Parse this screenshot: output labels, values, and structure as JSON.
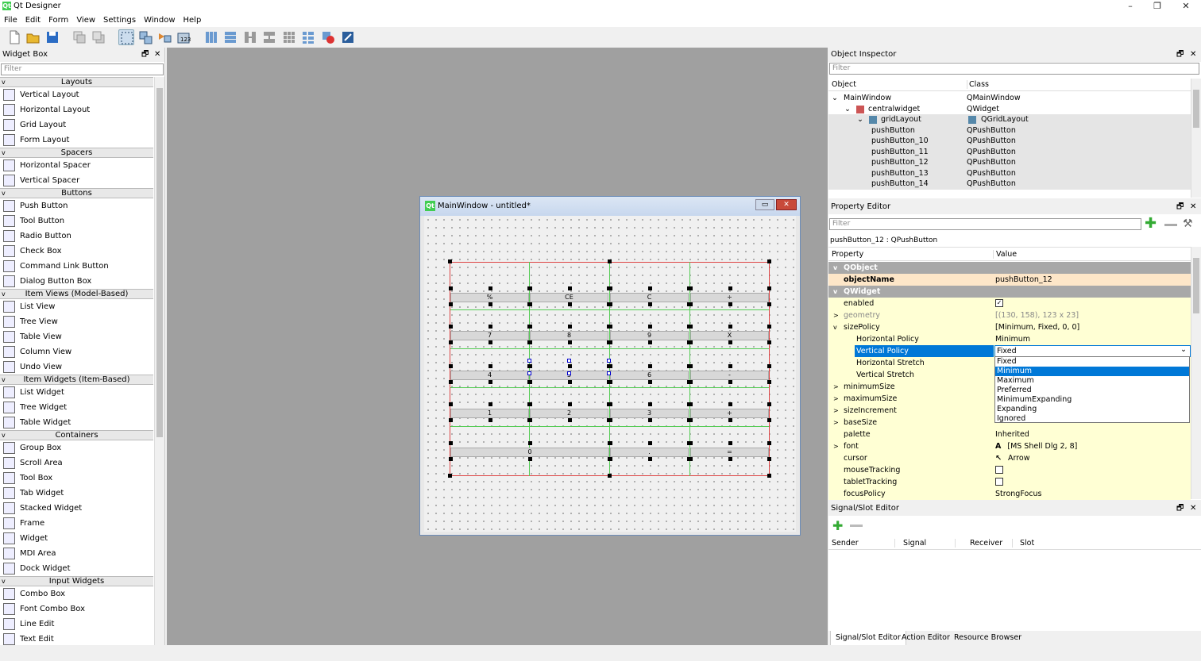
{
  "app": {
    "title": "Qt Designer",
    "icon": "qt-icon",
    "controls": [
      "–",
      "❐",
      "✕"
    ]
  },
  "menu": [
    "File",
    "Edit",
    "Form",
    "View",
    "Settings",
    "Window",
    "Help"
  ],
  "toolbar": [
    "new-icon",
    "open-icon",
    "save-icon",
    "send-backward-icon",
    "bring-forward-icon",
    "edit-widgets-icon",
    "edit-signals-icon",
    "edit-buddies-icon",
    "edit-tab-order-icon",
    "layout-horizontal-icon",
    "layout-vertical-icon",
    "layout-splitter-h-icon",
    "layout-splitter-v-icon",
    "layout-grid-icon",
    "layout-form-icon",
    "break-layout-icon",
    "adjust-size-icon"
  ],
  "widgetbox": {
    "title": "Widget Box",
    "filter": "Filter",
    "rows": [
      {
        "cat": "Layouts"
      },
      {
        "label": "Vertical Layout",
        "icon": "vertical-layout-icon"
      },
      {
        "label": "Horizontal Layout",
        "icon": "horizontal-layout-icon"
      },
      {
        "label": "Grid Layout",
        "icon": "grid-layout-icon"
      },
      {
        "label": "Form Layout",
        "icon": "form-layout-icon"
      },
      {
        "cat": "Spacers"
      },
      {
        "label": "Horizontal Spacer",
        "icon": "horizontal-spacer-icon"
      },
      {
        "label": "Vertical Spacer",
        "icon": "vertical-spacer-icon"
      },
      {
        "cat": "Buttons"
      },
      {
        "label": "Push Button",
        "icon": "push-button-icon"
      },
      {
        "label": "Tool Button",
        "icon": "tool-button-icon"
      },
      {
        "label": "Radio Button",
        "icon": "radio-button-icon"
      },
      {
        "label": "Check Box",
        "icon": "check-box-icon"
      },
      {
        "label": "Command Link Button",
        "icon": "command-link-icon"
      },
      {
        "label": "Dialog Button Box",
        "icon": "dialog-button-box-icon"
      },
      {
        "cat": "Item Views (Model-Based)"
      },
      {
        "label": "List View",
        "icon": "list-view-icon"
      },
      {
        "label": "Tree View",
        "icon": "tree-view-icon"
      },
      {
        "label": "Table View",
        "icon": "table-view-icon"
      },
      {
        "label": "Column View",
        "icon": "column-view-icon"
      },
      {
        "label": "Undo View",
        "icon": "undo-view-icon"
      },
      {
        "cat": "Item Widgets (Item-Based)"
      },
      {
        "label": "List Widget",
        "icon": "list-widget-icon"
      },
      {
        "label": "Tree Widget",
        "icon": "tree-widget-icon"
      },
      {
        "label": "Table Widget",
        "icon": "table-widget-icon"
      },
      {
        "cat": "Containers"
      },
      {
        "label": "Group Box",
        "icon": "group-box-icon"
      },
      {
        "label": "Scroll Area",
        "icon": "scroll-area-icon"
      },
      {
        "label": "Tool Box",
        "icon": "tool-box-icon"
      },
      {
        "label": "Tab Widget",
        "icon": "tab-widget-icon"
      },
      {
        "label": "Stacked Widget",
        "icon": "stacked-widget-icon"
      },
      {
        "label": "Frame",
        "icon": "frame-icon"
      },
      {
        "label": "Widget",
        "icon": "widget-icon"
      },
      {
        "label": "MDI Area",
        "icon": "mdi-area-icon"
      },
      {
        "label": "Dock Widget",
        "icon": "dock-widget-icon"
      },
      {
        "cat": "Input Widgets"
      },
      {
        "label": "Combo Box",
        "icon": "combo-box-icon"
      },
      {
        "label": "Font Combo Box",
        "icon": "font-combo-box-icon"
      },
      {
        "label": "Line Edit",
        "icon": "line-edit-icon"
      },
      {
        "label": "Text Edit",
        "icon": "text-edit-icon"
      }
    ]
  },
  "form": {
    "title": "MainWindow - untitled*",
    "buttons": [
      [
        "%",
        "CE",
        "C",
        "÷"
      ],
      [
        "7",
        "8",
        "9",
        "X"
      ],
      [
        "4",
        "5",
        "6",
        "-"
      ],
      [
        "1",
        "2",
        "3",
        "+"
      ],
      [
        "0",
        "",
        ".",
        "="
      ]
    ]
  },
  "objinsp": {
    "title": "Object Inspector",
    "filter": "Filter",
    "col_object": "Object",
    "col_class": "Class",
    "rows": [
      {
        "obj": "MainWindow",
        "cls": "QMainWindow",
        "level": 0,
        "exp": "v"
      },
      {
        "obj": "centralwidget",
        "cls": "QWidget",
        "level": 1,
        "exp": "v"
      },
      {
        "obj": "gridLayout",
        "cls": "QGridLayout",
        "level": 2,
        "exp": "v"
      },
      {
        "obj": "pushButton",
        "cls": "QPushButton",
        "level": 3
      },
      {
        "obj": "pushButton_10",
        "cls": "QPushButton",
        "level": 3
      },
      {
        "obj": "pushButton_11",
        "cls": "QPushButton",
        "level": 3
      },
      {
        "obj": "pushButton_12",
        "cls": "QPushButton",
        "level": 3
      },
      {
        "obj": "pushButton_13",
        "cls": "QPushButton",
        "level": 3
      },
      {
        "obj": "pushButton_14",
        "cls": "QPushButton",
        "level": 3
      }
    ]
  },
  "propedit": {
    "title": "Property Editor",
    "filter": "Filter",
    "context": "pushButton_12 : QPushButton",
    "col_property": "Property",
    "col_value": "Value",
    "rows": [
      {
        "k": "QObject",
        "v": "",
        "type": "grp"
      },
      {
        "k": "objectName",
        "v": "pushButton_12",
        "type": "obj",
        "bold": true
      },
      {
        "k": "QWidget",
        "v": "",
        "type": "grp"
      },
      {
        "k": "enabled",
        "v": "",
        "type": "yellow",
        "check": true,
        "checked": true
      },
      {
        "k": "geometry",
        "v": "[(130, 158), 123 x 23]",
        "type": "yellow",
        "exp": ">",
        "dim": true
      },
      {
        "k": "sizePolicy",
        "v": "[Minimum, Fixed, 0, 0]",
        "type": "yellow",
        "exp": "v"
      },
      {
        "k": "Horizontal Policy",
        "v": "Minimum",
        "type": "yellow",
        "sub": true
      },
      {
        "k": "Vertical Policy",
        "v": "Fixed",
        "type": "yellow",
        "sub": true,
        "selected": true
      },
      {
        "k": "Horizontal Stretch",
        "v": "",
        "type": "yellow",
        "sub": true
      },
      {
        "k": "Vertical Stretch",
        "v": "",
        "type": "yellow",
        "sub": true
      },
      {
        "k": "minimumSize",
        "v": "",
        "type": "yellow",
        "exp": ">"
      },
      {
        "k": "maximumSize",
        "v": "",
        "type": "yellow",
        "exp": ">"
      },
      {
        "k": "sizeIncrement",
        "v": "",
        "type": "yellow",
        "exp": ">"
      },
      {
        "k": "baseSize",
        "v": "",
        "type": "yellow",
        "exp": ">"
      },
      {
        "k": "palette",
        "v": "Inherited",
        "type": "yellow"
      },
      {
        "k": "font",
        "v": "[MS Shell Dlg 2, 8]",
        "type": "yellow",
        "exp": ">",
        "icon": "A"
      },
      {
        "k": "cursor",
        "v": "Arrow",
        "type": "yellow",
        "icon": "↖"
      },
      {
        "k": "mouseTracking",
        "v": "",
        "type": "yellow",
        "check": true
      },
      {
        "k": "tabletTracking",
        "v": "",
        "type": "yellow",
        "check": true
      },
      {
        "k": "focusPolicy",
        "v": "StrongFocus",
        "type": "yellow"
      }
    ],
    "dropdown": {
      "selected": "Minimum",
      "options": [
        "Fixed",
        "Minimum",
        "Maximum",
        "Preferred",
        "MinimumExpanding",
        "Expanding",
        "Ignored"
      ]
    }
  },
  "sigslot": {
    "title": "Signal/Slot Editor",
    "cols": [
      "Sender",
      "Signal",
      "Receiver",
      "Slot"
    ]
  },
  "bottom_tabs": [
    "Signal/Slot Editor",
    "Action Editor",
    "Resource Browser"
  ]
}
